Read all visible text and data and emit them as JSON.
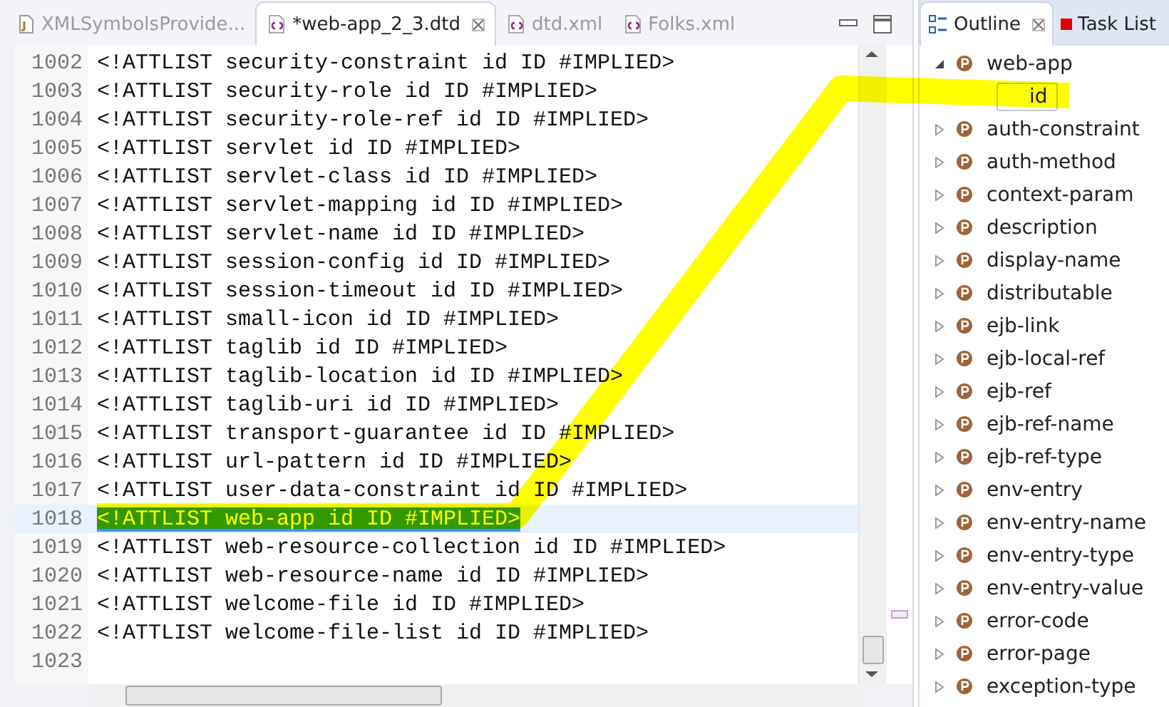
{
  "editor": {
    "tabs": [
      {
        "label": "XMLSymbolsProvide...",
        "selected": false
      },
      {
        "label": "*web-app_2_3.dtd",
        "selected": true
      },
      {
        "label": "dtd.xml",
        "selected": false
      },
      {
        "label": "Folks.xml",
        "selected": false
      }
    ],
    "lines": [
      {
        "number": "1002",
        "text": "<!ATTLIST security-constraint id ID #IMPLIED>",
        "selected": false
      },
      {
        "number": "1003",
        "text": "<!ATTLIST security-role id ID #IMPLIED>",
        "selected": false
      },
      {
        "number": "1004",
        "text": "<!ATTLIST security-role-ref id ID #IMPLIED>",
        "selected": false
      },
      {
        "number": "1005",
        "text": "<!ATTLIST servlet id ID #IMPLIED>",
        "selected": false
      },
      {
        "number": "1006",
        "text": "<!ATTLIST servlet-class id ID #IMPLIED>",
        "selected": false
      },
      {
        "number": "1007",
        "text": "<!ATTLIST servlet-mapping id ID #IMPLIED>",
        "selected": false
      },
      {
        "number": "1008",
        "text": "<!ATTLIST servlet-name id ID #IMPLIED>",
        "selected": false
      },
      {
        "number": "1009",
        "text": "<!ATTLIST session-config id ID #IMPLIED>",
        "selected": false
      },
      {
        "number": "1010",
        "text": "<!ATTLIST session-timeout id ID #IMPLIED>",
        "selected": false
      },
      {
        "number": "1011",
        "text": "<!ATTLIST small-icon id ID #IMPLIED>",
        "selected": false
      },
      {
        "number": "1012",
        "text": "<!ATTLIST taglib id ID #IMPLIED>",
        "selected": false
      },
      {
        "number": "1013",
        "text": "<!ATTLIST taglib-location id ID #IMPLIED>",
        "selected": false
      },
      {
        "number": "1014",
        "text": "<!ATTLIST taglib-uri id ID #IMPLIED>",
        "selected": false
      },
      {
        "number": "1015",
        "text": "<!ATTLIST transport-guarantee id ID #IMPLIED>",
        "selected": false
      },
      {
        "number": "1016",
        "text": "<!ATTLIST url-pattern id ID #IMPLIED>",
        "selected": false
      },
      {
        "number": "1017",
        "text": "<!ATTLIST user-data-constraint id ID #IMPLIED>",
        "selected": false
      },
      {
        "number": "1018",
        "text": "<!ATTLIST web-app id ID #IMPLIED>",
        "selected": true
      },
      {
        "number": "1019",
        "text": "<!ATTLIST web-resource-collection id ID #IMPLIED>",
        "selected": false
      },
      {
        "number": "1020",
        "text": "<!ATTLIST web-resource-name id ID #IMPLIED>",
        "selected": false
      },
      {
        "number": "1021",
        "text": "<!ATTLIST welcome-file id ID #IMPLIED>",
        "selected": false
      },
      {
        "number": "1022",
        "text": "<!ATTLIST welcome-file-list id ID #IMPLIED>",
        "selected": false
      },
      {
        "number": "1023",
        "selected": false
      }
    ]
  },
  "side": {
    "tabs": [
      {
        "label": "Outline",
        "selected": true
      },
      {
        "label": "Task List",
        "selected": false
      }
    ],
    "tree": [
      {
        "label": "web-app",
        "expanded": true,
        "selected": false,
        "children": [
          {
            "label": "id",
            "kind": "attribute",
            "selected": true
          }
        ]
      },
      {
        "label": "auth-constraint",
        "expanded": false,
        "selected": false
      },
      {
        "label": "auth-method",
        "expanded": false,
        "selected": false
      },
      {
        "label": "context-param",
        "expanded": false,
        "selected": false
      },
      {
        "label": "description",
        "expanded": false,
        "selected": false
      },
      {
        "label": "display-name",
        "expanded": false,
        "selected": false
      },
      {
        "label": "distributable",
        "expanded": false,
        "selected": false
      },
      {
        "label": "ejb-link",
        "expanded": false,
        "selected": false
      },
      {
        "label": "ejb-local-ref",
        "expanded": false,
        "selected": false
      },
      {
        "label": "ejb-ref",
        "expanded": false,
        "selected": false
      },
      {
        "label": "ejb-ref-name",
        "expanded": false,
        "selected": false
      },
      {
        "label": "ejb-ref-type",
        "expanded": false,
        "selected": false
      },
      {
        "label": "env-entry",
        "expanded": false,
        "selected": false
      },
      {
        "label": "env-entry-name",
        "expanded": false,
        "selected": false
      },
      {
        "label": "env-entry-type",
        "expanded": false,
        "selected": false
      },
      {
        "label": "env-entry-value",
        "expanded": false,
        "selected": false
      },
      {
        "label": "error-code",
        "expanded": false,
        "selected": false
      },
      {
        "label": "error-page",
        "expanded": false,
        "selected": false
      },
      {
        "label": "exception-type",
        "expanded": false,
        "selected": false
      }
    ]
  }
}
